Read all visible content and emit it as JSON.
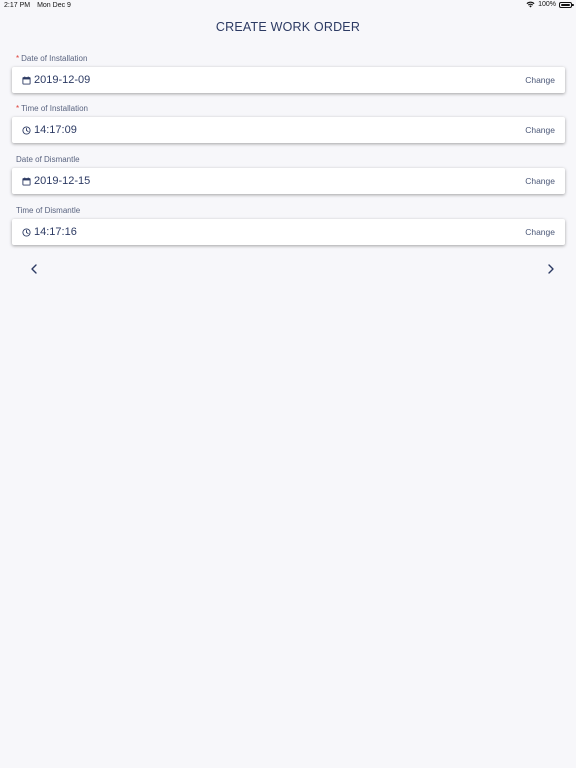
{
  "status_bar": {
    "time": "2:17 PM",
    "date": "Mon Dec 9",
    "battery": "100%",
    "battery_level": 1.0
  },
  "header": {
    "title": "CREATE WORK ORDER"
  },
  "fields": [
    {
      "label": "Date of Installation",
      "required": true,
      "required_mark": "*",
      "icon": "calendar-icon",
      "value": "2019-12-09",
      "action": "Change"
    },
    {
      "label": "Time of Installation",
      "required": true,
      "required_mark": "*",
      "icon": "clock-icon",
      "value": "14:17:09",
      "action": "Change"
    },
    {
      "label": "Date of Dismantle",
      "required": false,
      "icon": "calendar-icon",
      "value": "2019-12-15",
      "action": "Change"
    },
    {
      "label": "Time of Dismantle",
      "required": false,
      "icon": "clock-icon",
      "value": "14:17:16",
      "action": "Change"
    }
  ],
  "navigation": {
    "prev_icon": "chevron-left-icon",
    "next_icon": "chevron-right-icon"
  },
  "colors": {
    "background": "#f7f7fa",
    "primary_text": "#2c3a63",
    "required": "#e0403a"
  }
}
